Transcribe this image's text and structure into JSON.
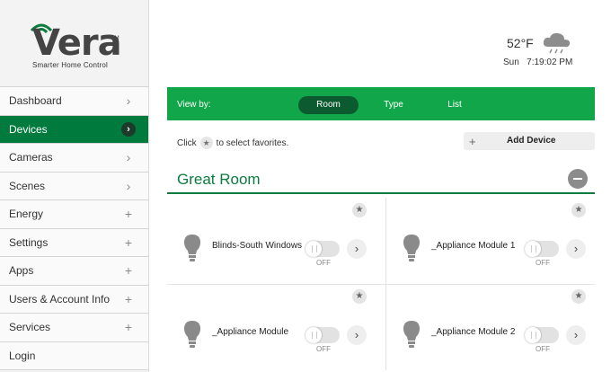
{
  "brand": {
    "name": "Vera",
    "trademark": "TM",
    "tagline": "Smarter Home Control",
    "color": "#0c7b3e"
  },
  "sidebar": {
    "items": [
      {
        "label": "Dashboard",
        "indicator": "chevron",
        "active": false
      },
      {
        "label": "Devices",
        "indicator": "chevron",
        "active": true
      },
      {
        "label": "Cameras",
        "indicator": "chevron",
        "active": false
      },
      {
        "label": "Scenes",
        "indicator": "chevron",
        "active": false
      },
      {
        "label": "Energy",
        "indicator": "plus",
        "active": false
      },
      {
        "label": "Settings",
        "indicator": "plus",
        "active": false
      },
      {
        "label": "Apps",
        "indicator": "plus",
        "active": false
      },
      {
        "label": "Users & Account Info",
        "indicator": "plus",
        "active": false
      },
      {
        "label": "Services",
        "indicator": "plus",
        "active": false
      },
      {
        "label": "Login",
        "indicator": "none",
        "active": false
      }
    ]
  },
  "weather": {
    "temperature": "52°F",
    "day": "Sun",
    "time": "7:19:02 PM",
    "icon": "cloud-rain-icon"
  },
  "view_by": {
    "label": "View by:",
    "options": [
      {
        "label": "Room",
        "selected": true
      },
      {
        "label": "Type",
        "selected": false
      },
      {
        "label": "List",
        "selected": false
      }
    ],
    "bar_color": "#12a64b"
  },
  "favorites_hint": {
    "before": "Click",
    "after": "to select favorites."
  },
  "add_device": {
    "label": "Add Device"
  },
  "room": {
    "title": "Great Room",
    "devices": [
      {
        "name": "Blinds-South Windows",
        "state": "OFF"
      },
      {
        "name": "_Appliance Module 1",
        "state": "OFF"
      },
      {
        "name": "_Appliance Module",
        "state": "OFF"
      },
      {
        "name": "_Appliance Module 2",
        "state": "OFF"
      }
    ]
  }
}
